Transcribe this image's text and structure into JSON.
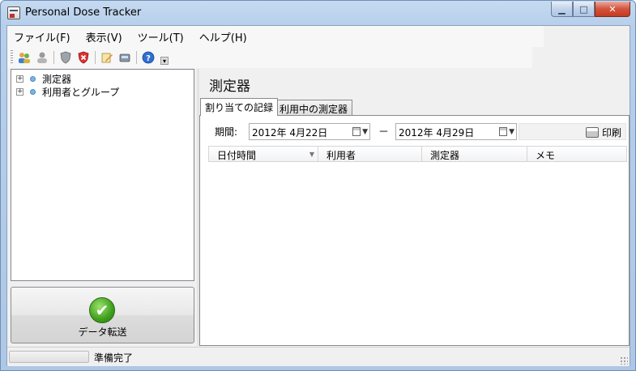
{
  "window": {
    "title": "Personal Dose Tracker",
    "minimize": "▁",
    "maximize": "□",
    "close": "✕"
  },
  "menu": {
    "items": [
      "ファイル(F)",
      "表示(V)",
      "ツール(T)",
      "ヘルプ(H)"
    ]
  },
  "toolbar": {
    "icons": [
      "users-icon",
      "user-gray-icon",
      "shield-icon",
      "shield-red-icon",
      "edit-icon",
      "device-icon",
      "help-icon"
    ],
    "overflow": "▾"
  },
  "tree": {
    "items": [
      {
        "expander": "+",
        "label": "測定器"
      },
      {
        "expander": "+",
        "label": "利用者とグループ"
      }
    ]
  },
  "transfer_button": {
    "label": "データ転送",
    "check": "✔"
  },
  "right": {
    "title": "測定器",
    "tabs": [
      "割り当ての記録",
      "利用中の測定器"
    ],
    "period_label": "期間:",
    "start_date": "2012年  4月22日",
    "end_date": "2012年  4月29日",
    "dash": "－",
    "print_label": "印刷",
    "columns": [
      "日付時間",
      "利用者",
      "測定器",
      "メモ"
    ],
    "sort_indicator": "▼"
  },
  "status": {
    "text": "準備完了"
  }
}
